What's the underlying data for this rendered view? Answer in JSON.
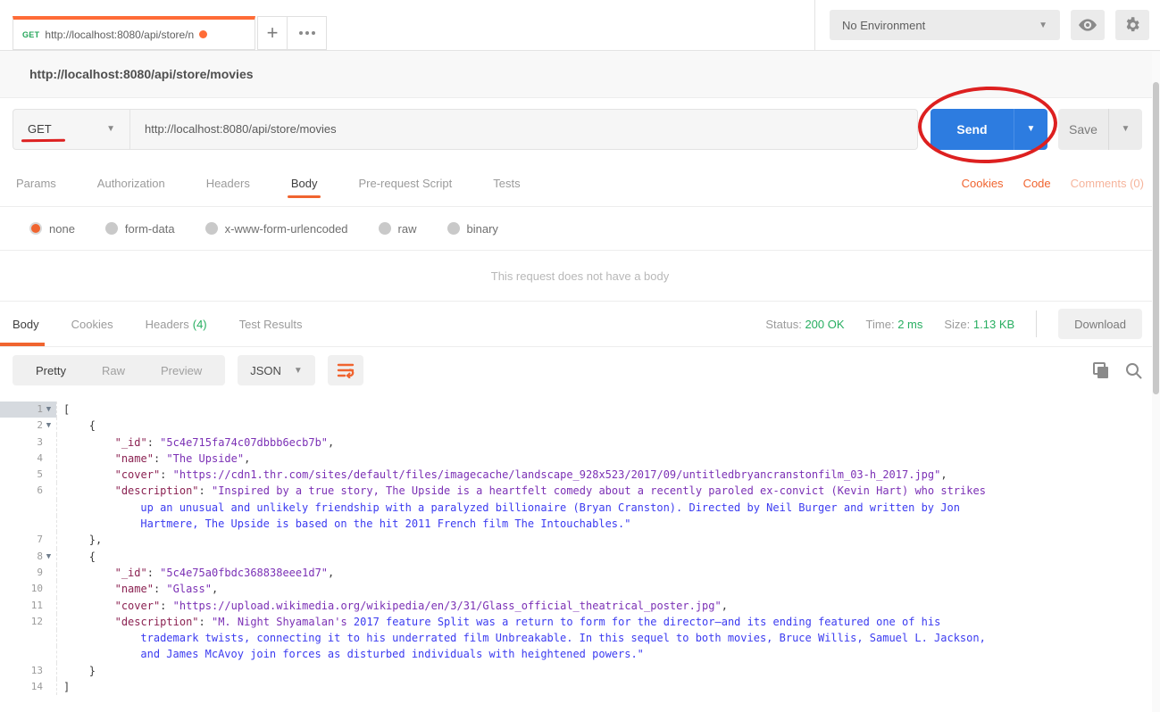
{
  "topbar": {
    "tab": {
      "method": "GET",
      "title": "http://localhost:8080/api/store/n"
    },
    "new_tab_label": "+",
    "more_tabs_label": "...",
    "environment_label": "No Environment"
  },
  "url_header": {
    "url": "http://localhost:8080/api/store/movies"
  },
  "request": {
    "method_label": "GET",
    "url_value": "http://localhost:8080/api/store/movies",
    "send_label": "Send",
    "save_label": "Save"
  },
  "request_tabs": [
    "Params",
    "Authorization",
    "Headers",
    "Body",
    "Pre-request Script",
    "Tests"
  ],
  "request_links": [
    "Cookies",
    "Code",
    "Comments (0)"
  ],
  "body_options": [
    "none",
    "form-data",
    "x-www-form-urlencoded",
    "raw",
    "binary"
  ],
  "empty_body": {
    "message": "This request does not have a body"
  },
  "response": {
    "tabs": {
      "body": "Body",
      "cookies": "Cookies",
      "headers": "Headers",
      "headers_count": "(4)",
      "tests": "Test Results"
    },
    "meta": {
      "status_label": "Status:",
      "status_value": "200 OK",
      "time_label": "Time:",
      "time_value": "2 ms",
      "size_label": "Size:",
      "size_value": "1.13 KB"
    },
    "download_label": "Download",
    "viewer": {
      "views": [
        "Pretty",
        "Raw",
        "Preview"
      ],
      "format_label": "JSON",
      "lines": [
        {
          "num": "1",
          "fold": true,
          "active": true,
          "indent": 0,
          "segs": [
            {
              "c": "p",
              "t": "["
            }
          ]
        },
        {
          "num": "2",
          "fold": true,
          "indent": 4,
          "segs": [
            {
              "c": "p",
              "t": "{"
            }
          ]
        },
        {
          "num": "3",
          "indent": 8,
          "segs": [
            {
              "c": "k",
              "t": "\"_id\""
            },
            {
              "c": "p",
              "t": ": "
            },
            {
              "c": "v",
              "t": "\"5c4e715fa74c07dbbb6ecb7b\""
            },
            {
              "c": "p",
              "t": ","
            }
          ]
        },
        {
          "num": "4",
          "indent": 8,
          "segs": [
            {
              "c": "k",
              "t": "\"name\""
            },
            {
              "c": "p",
              "t": ": "
            },
            {
              "c": "v",
              "t": "\"The Upside\""
            },
            {
              "c": "p",
              "t": ","
            }
          ]
        },
        {
          "num": "5",
          "indent": 8,
          "segs": [
            {
              "c": "k",
              "t": "\"cover\""
            },
            {
              "c": "p",
              "t": ": "
            },
            {
              "c": "v",
              "t": "\"https://cdn1.thr.com/sites/default/files/imagecache/landscape_928x523/2017/09/untitledbryancranstonfilm_03-h_2017.jpg\""
            },
            {
              "c": "p",
              "t": ","
            }
          ]
        },
        {
          "num": "6",
          "indent": 8,
          "segs": [
            {
              "c": "k",
              "t": "\"description\""
            },
            {
              "c": "p",
              "t": ": "
            },
            {
              "c": "v",
              "t": "\"Inspired by a true story, The Upside is a heartfelt comedy about a recently paroled ex-convict (Kevin Hart) who strikes"
            }
          ]
        },
        {
          "num": "",
          "indent": 12,
          "segs": [
            {
              "c": "b",
              "t": "up an unusual and unlikely friendship with a paralyzed billionaire (Bryan Cranston). Directed by Neil Burger and written by Jon"
            }
          ]
        },
        {
          "num": "",
          "indent": 12,
          "segs": [
            {
              "c": "b",
              "t": "Hartmere, The Upside is based on the hit 2011 French film The Intouchables.\""
            }
          ]
        },
        {
          "num": "7",
          "indent": 4,
          "segs": [
            {
              "c": "p",
              "t": "},"
            }
          ]
        },
        {
          "num": "8",
          "fold": true,
          "indent": 4,
          "segs": [
            {
              "c": "p",
              "t": "{"
            }
          ]
        },
        {
          "num": "9",
          "indent": 8,
          "segs": [
            {
              "c": "k",
              "t": "\"_id\""
            },
            {
              "c": "p",
              "t": ": "
            },
            {
              "c": "v",
              "t": "\"5c4e75a0fbdc368838eee1d7\""
            },
            {
              "c": "p",
              "t": ","
            }
          ]
        },
        {
          "num": "10",
          "indent": 8,
          "segs": [
            {
              "c": "k",
              "t": "\"name\""
            },
            {
              "c": "p",
              "t": ": "
            },
            {
              "c": "v",
              "t": "\"Glass\""
            },
            {
              "c": "p",
              "t": ","
            }
          ]
        },
        {
          "num": "11",
          "indent": 8,
          "segs": [
            {
              "c": "k",
              "t": "\"cover\""
            },
            {
              "c": "p",
              "t": ": "
            },
            {
              "c": "v",
              "t": "\"https://upload.wikimedia.org/wikipedia/en/3/31/Glass_official_theatrical_poster.jpg\""
            },
            {
              "c": "p",
              "t": ","
            }
          ]
        },
        {
          "num": "12",
          "indent": 8,
          "segs": [
            {
              "c": "k",
              "t": "\"description\""
            },
            {
              "c": "p",
              "t": ": "
            },
            {
              "c": "v",
              "t": "\"M. Night Shyamalan's"
            },
            {
              "c": "b",
              "t": " 2017 feature Split was a return to form for the director—and its ending featured one of his"
            }
          ]
        },
        {
          "num": "",
          "indent": 12,
          "segs": [
            {
              "c": "b",
              "t": "trademark twists, connecting it to his underrated film Unbreakable. In this sequel to both movies, Bruce Willis, Samuel L. Jackson,"
            }
          ]
        },
        {
          "num": "",
          "indent": 12,
          "segs": [
            {
              "c": "b",
              "t": "and James McAvoy join forces as disturbed individuals with heightened powers.\""
            }
          ]
        },
        {
          "num": "13",
          "indent": 4,
          "segs": [
            {
              "c": "p",
              "t": "}"
            }
          ]
        },
        {
          "num": "14",
          "indent": 0,
          "segs": [
            {
              "c": "p",
              "t": "]"
            }
          ]
        }
      ]
    }
  },
  "colors": {
    "accent_orange": "#ff6c37",
    "send_blue": "#2d7ce0",
    "success_green": "#27ae60",
    "method_green": "#26a65b",
    "annotation_red": "#dd2020",
    "json_key": "#8b2252",
    "json_string": "#7b30b5",
    "json_string_wrap": "#3b3bf0"
  }
}
